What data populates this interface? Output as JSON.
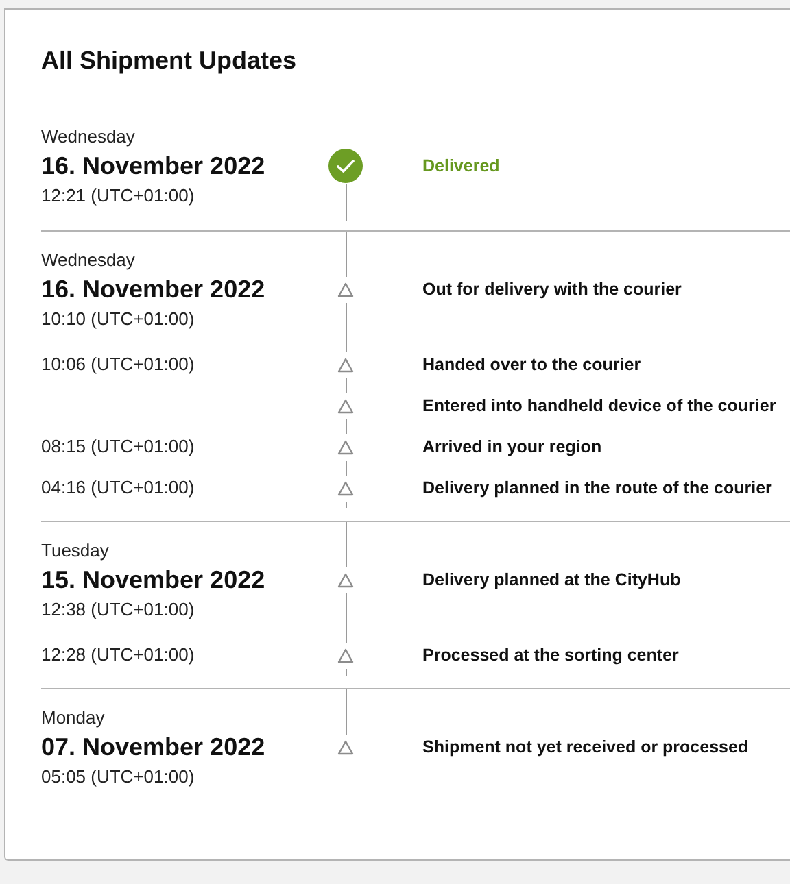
{
  "title": "All Shipment Updates",
  "groups": [
    {
      "weekday": "Wednesday",
      "date": "16. November 2022",
      "events": [
        {
          "kind": "delivered",
          "time": "12:21 (UTC+01:00)",
          "description": "Delivered"
        }
      ]
    },
    {
      "weekday": "Wednesday",
      "date": "16. November 2022",
      "events": [
        {
          "kind": "step",
          "time": "10:10 (UTC+01:00)",
          "description": "Out for delivery with the courier"
        },
        {
          "kind": "step",
          "time": "10:06 (UTC+01:00)",
          "description": "Handed over to the courier"
        },
        {
          "kind": "step",
          "description": "Entered into handheld device of the courier"
        },
        {
          "kind": "step",
          "time": "08:15 (UTC+01:00)",
          "description": "Arrived in your region"
        },
        {
          "kind": "step",
          "time": "04:16 (UTC+01:00)",
          "description": "Delivery planned in the route of the courier"
        }
      ]
    },
    {
      "weekday": "Tuesday",
      "date": "15. November 2022",
      "events": [
        {
          "kind": "step",
          "time": "12:38 (UTC+01:00)",
          "description": "Delivery planned at the CityHub"
        },
        {
          "kind": "step",
          "time": "12:28 (UTC+01:00)",
          "description": "Processed at the sorting center"
        }
      ]
    },
    {
      "weekday": "Monday",
      "date": "07. November 2022",
      "events": [
        {
          "kind": "step",
          "time": "05:05 (UTC+01:00)",
          "description": "Shipment not yet received or processed"
        }
      ]
    }
  ]
}
